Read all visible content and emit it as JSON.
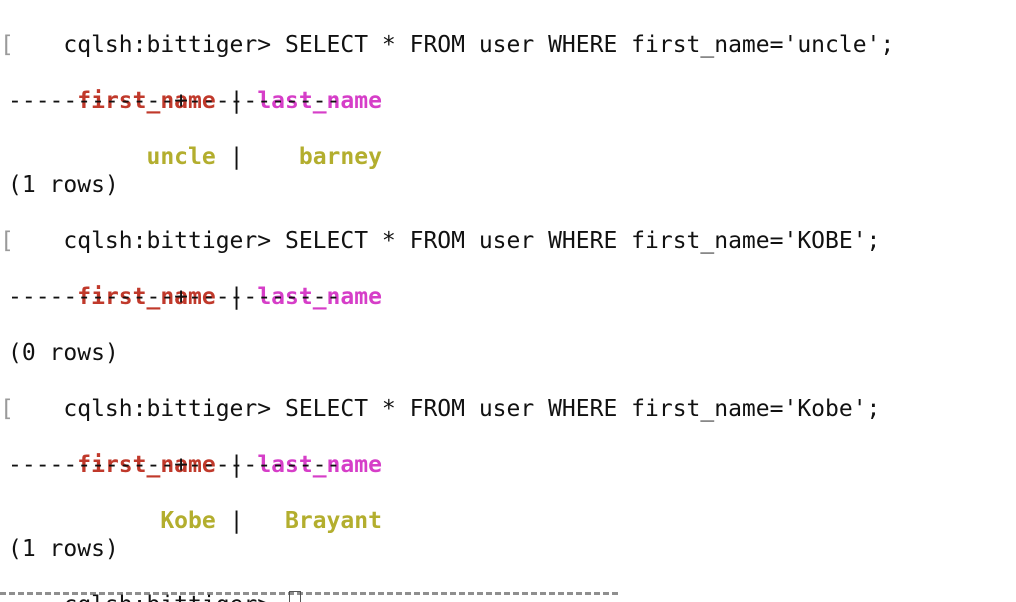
{
  "prompt": "cqlsh:bittiger>",
  "blocks": [
    {
      "command": "SELECT * FROM user WHERE first_name='uncle';",
      "header_first": "first_name",
      "header_last": "last_name",
      "header_sep": "|",
      "rule": "------------+-----------",
      "rows": [
        {
          "first": "uncle",
          "last": "barney"
        }
      ],
      "summary": "(1 rows)"
    },
    {
      "command": "SELECT * FROM user WHERE first_name='KOBE';",
      "header_first": "first_name",
      "header_last": "last_name",
      "header_sep": "|",
      "rule": "------------+-----------",
      "rows": [],
      "summary": "(0 rows)"
    },
    {
      "command": "SELECT * FROM user WHERE first_name='Kobe';",
      "header_first": "first_name",
      "header_last": "last_name",
      "header_sep": "|",
      "rule": "------------+-----------",
      "rows": [
        {
          "first": "Kobe",
          "last": "Brayant"
        }
      ],
      "summary": "(1 rows)"
    }
  ],
  "cell_sep": "|",
  "colors": {
    "header_first": "#c0392b",
    "header_last": "#d63ec8",
    "cell": "#b3ae2e",
    "text": "#111111",
    "background": "#ffffff"
  }
}
